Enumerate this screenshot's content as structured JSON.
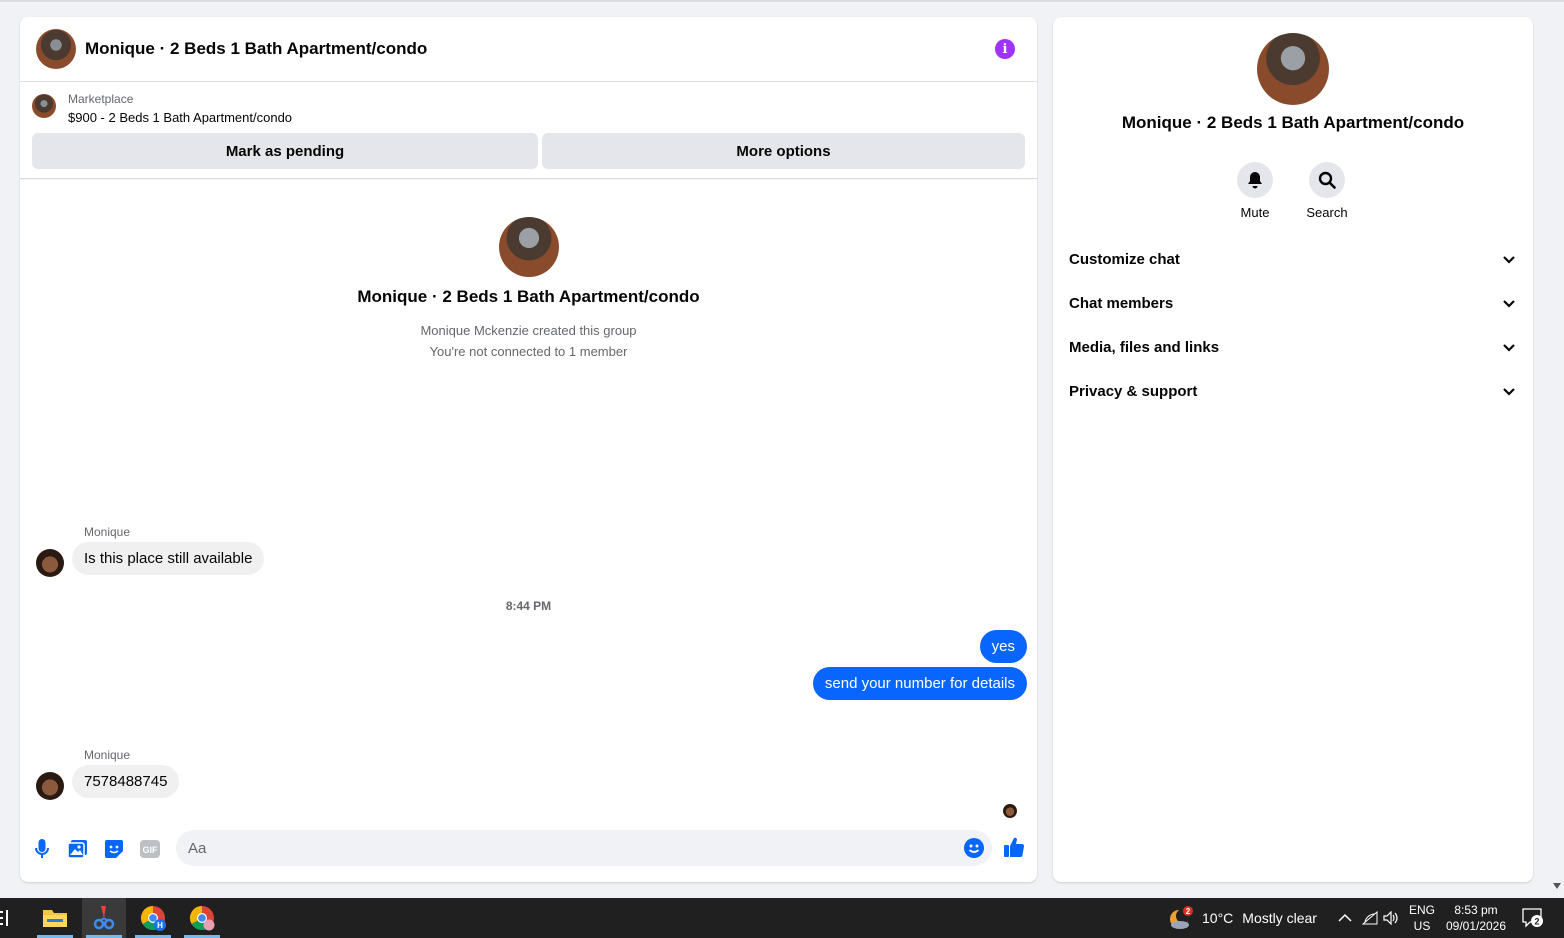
{
  "chat": {
    "title": "Monique · 2 Beds 1 Bath Apartment/condo",
    "marketplace": {
      "label": "Marketplace",
      "listing": "$900 - 2 Beds 1 Bath Apartment/condo",
      "pending_button": "Mark as pending",
      "more_button": "More options"
    },
    "intro": {
      "title": "Monique · 2 Beds 1 Bath Apartment/condo",
      "created": "Monique Mckenzie created this group",
      "connection": "You're not connected to 1 member"
    },
    "messages": [
      {
        "sender": "Monique",
        "text": "Is this place still available"
      },
      {
        "timestamp": "8:44 PM"
      },
      {
        "text": "yes"
      },
      {
        "text": "send your number for details"
      },
      {
        "sender": "Monique",
        "text": "7578488745"
      }
    ],
    "composer": {
      "placeholder": "Aa",
      "gif_label": "GIF"
    }
  },
  "side": {
    "title": "Monique · 2 Beds 1 Bath Apartment/condo",
    "actions": {
      "mute": "Mute",
      "search": "Search"
    },
    "sections": [
      "Customize chat",
      "Chat members",
      "Media, files and links",
      "Privacy & support"
    ]
  },
  "taskbar": {
    "weather": {
      "temp": "10°C",
      "condition": "Mostly clear",
      "badge": "2"
    },
    "lang": {
      "top": "ENG",
      "bottom": "US"
    },
    "clock": {
      "time": "8:53 pm",
      "date": "09/01/2026"
    },
    "notifications": "2"
  },
  "colors": {
    "accent": "#0866ff",
    "info": "#a033ff",
    "bubble_in": "#f0f0f0",
    "taskbar": "#202020"
  }
}
